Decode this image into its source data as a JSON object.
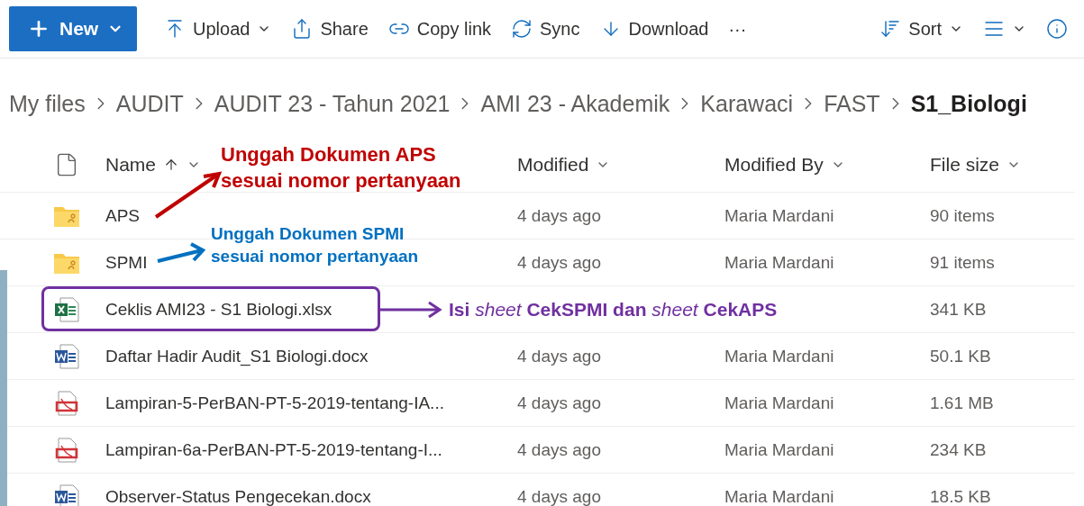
{
  "toolbar": [
    {
      "kind": "new",
      "label": "New"
    },
    {
      "kind": "upload",
      "label": "Upload",
      "dropdown": true
    },
    {
      "kind": "share",
      "label": "Share",
      "dropdown": false
    },
    {
      "kind": "link",
      "label": "Copy link",
      "dropdown": false
    },
    {
      "kind": "sync",
      "label": "Sync",
      "dropdown": false
    },
    {
      "kind": "download",
      "label": "Download",
      "dropdown": false
    },
    {
      "kind": "more",
      "label": "···"
    }
  ],
  "view_controls": [
    {
      "kind": "sort",
      "label": "Sort",
      "dropdown": true
    },
    {
      "kind": "view",
      "dropdown": true
    },
    {
      "kind": "info"
    }
  ],
  "breadcrumb": [
    {
      "label": "My files",
      "current": false
    },
    {
      "label": "AUDIT",
      "current": false
    },
    {
      "label": "AUDIT 23 - Tahun 2021",
      "current": false
    },
    {
      "label": "AMI 23 - Akademik",
      "current": false
    },
    {
      "label": "Karawaci",
      "current": false
    },
    {
      "label": "FAST",
      "current": false
    },
    {
      "label": "S1_Biologi",
      "current": true
    }
  ],
  "table": {
    "columns": [
      {
        "label": "Name",
        "sorted": true
      },
      {
        "label": "Modified",
        "sorted": false
      },
      {
        "label": "Modified By",
        "sorted": false
      },
      {
        "label": "File size",
        "sorted": false
      }
    ],
    "rows": [
      {
        "kind": "folder",
        "name": "APS",
        "modified": "4 days ago",
        "modified_by": "Maria Mardani",
        "size": "90 items"
      },
      {
        "kind": "folder",
        "name": "SPMI",
        "modified": "4 days ago",
        "modified_by": "Maria Mardani",
        "size": "91 items"
      },
      {
        "kind": "excel",
        "name": "Ceklis AMI23 - S1 Biologi.xlsx",
        "size": "341 KB"
      },
      {
        "kind": "word",
        "name": "Daftar Hadir Audit_S1 Biologi.docx",
        "modified": "4 days ago",
        "modified_by": "Maria Mardani",
        "size": "50.1 KB"
      },
      {
        "kind": "pdf",
        "name": "Lampiran-5-PerBAN-PT-5-2019-tentang-IA...",
        "modified": "4 days ago",
        "modified_by": "Maria Mardani",
        "size": "1.61 MB"
      },
      {
        "kind": "pdf",
        "name": "Lampiran-6a-PerBAN-PT-5-2019-tentang-I...",
        "modified": "4 days ago",
        "modified_by": "Maria Mardani",
        "size": "234 KB"
      },
      {
        "kind": "word",
        "name": "Observer-Status Pengecekan.docx",
        "modified": "4 days ago",
        "modified_by": "Maria Mardani",
        "size": "18.5 KB"
      }
    ]
  },
  "annotations": [
    {
      "kind": "aps",
      "color": "#c00000",
      "lines": [
        "Unggah Dokumen APS",
        "sesuai nomor pertanyaan"
      ]
    },
    {
      "kind": "spmi",
      "color": "#0070c0",
      "lines": [
        "Unggah Dokumen SPMI",
        "sesuai nomor pertanyaan"
      ]
    },
    {
      "kind": "ceklis",
      "color": "#7030a0",
      "lines": [
        "**Isi** *sheet* **CekSPMI dan** *sheet* **CekAPS**"
      ]
    }
  ]
}
